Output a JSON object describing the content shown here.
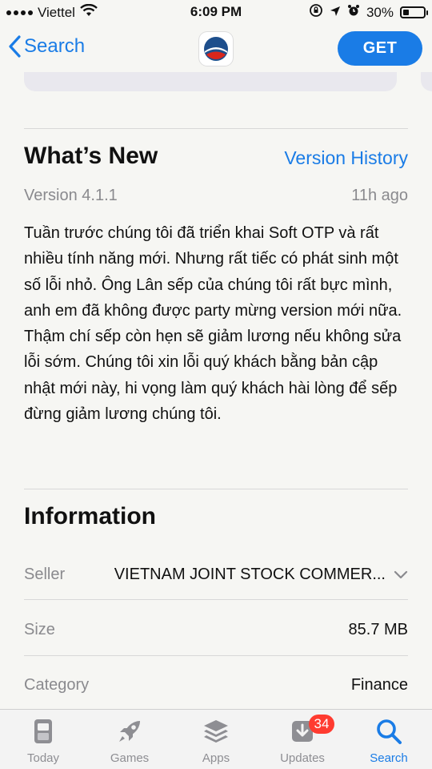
{
  "status_bar": {
    "carrier": "Viettel",
    "time": "6:09 PM",
    "battery_percent": "30%",
    "battery_level": 0.3,
    "icons": [
      "signal-icon",
      "wifi-icon",
      "orientation-lock-icon",
      "location-icon",
      "alarm-icon",
      "battery-icon"
    ]
  },
  "nav": {
    "back_label": "Search",
    "get_label": "GET"
  },
  "whats_new": {
    "title": "What’s New",
    "version_history_link": "Version History",
    "version": "Version 4.1.1",
    "age": "11h ago",
    "notes": "Tuần trước chúng tôi đã triển khai Soft OTP và rất nhiều tính năng mới. Nhưng rất tiếc có phát sinh một số lỗi nhỏ. Ông Lân sếp của chúng tôi rất bực mình, anh em đã không được party mừng version mới nữa. Thậm chí sếp còn hẹn sẽ giảm lương nếu không sửa lỗi sớm. Chúng tôi xin lỗi quý khách bằng bản cập nhật mới này, hi vọng làm quý khách hài lòng để sếp đừng giảm lương chúng tôi."
  },
  "information": {
    "title": "Information",
    "rows": [
      {
        "key": "Seller",
        "value": "VIETNAM JOINT STOCK COMMER..."
      },
      {
        "key": "Size",
        "value": "85.7 MB"
      },
      {
        "key": "Category",
        "value": "Finance"
      }
    ]
  },
  "tabbar": {
    "tabs": [
      {
        "label": "Today",
        "icon": "today-icon"
      },
      {
        "label": "Games",
        "icon": "rocket-icon"
      },
      {
        "label": "Apps",
        "icon": "layers-icon"
      },
      {
        "label": "Updates",
        "icon": "download-icon",
        "badge": "34"
      },
      {
        "label": "Search",
        "icon": "search-icon",
        "active": true
      }
    ]
  },
  "colors": {
    "accent": "#1a7ce6",
    "badge": "#ff3b30",
    "secondary_text": "#8a8a8e"
  }
}
